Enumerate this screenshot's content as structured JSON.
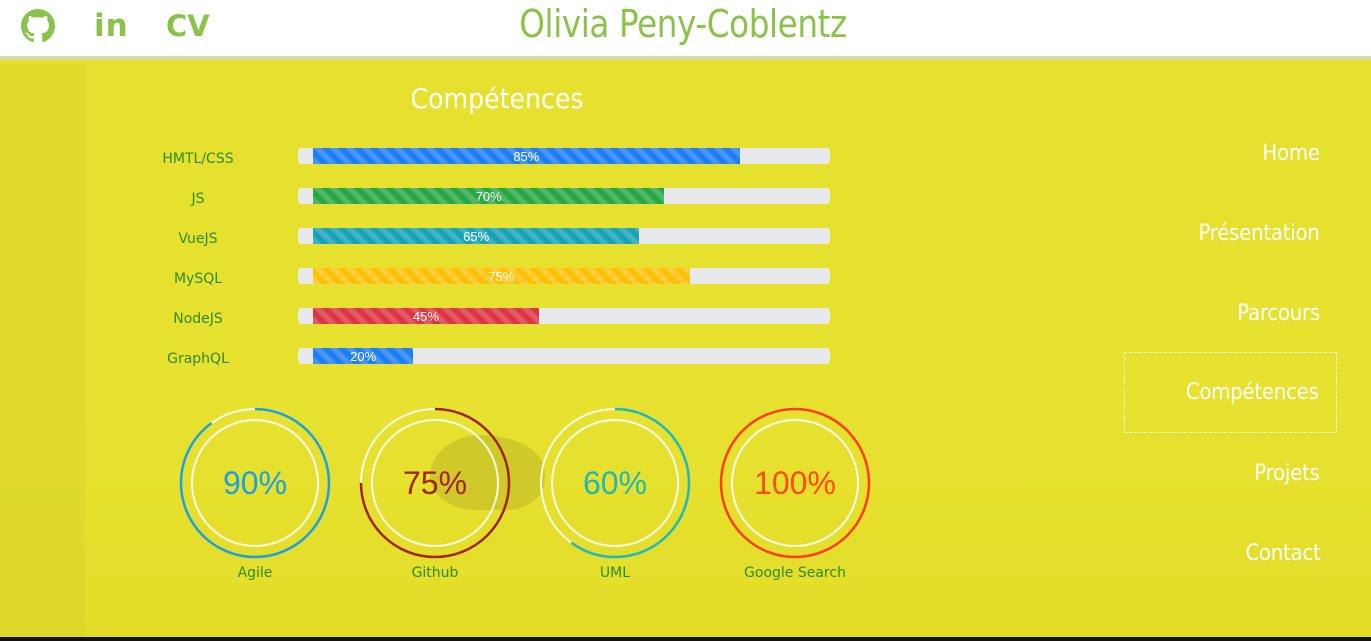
{
  "header": {
    "title": "Olivia Peny-Coblentz",
    "social": [
      {
        "icon": "github-icon",
        "label": ""
      },
      {
        "icon": "linkedin-icon",
        "label": "in"
      },
      {
        "icon": "cv-icon",
        "label": "CV"
      }
    ],
    "accent_color": "#8bc34a"
  },
  "skills": {
    "title": "Compétences",
    "bars": [
      {
        "label": "HMTL/CSS",
        "percent": 85,
        "text": "85%",
        "color": "#1e7ef5"
      },
      {
        "label": "JS",
        "percent": 70,
        "text": "70%",
        "color": "#28a745"
      },
      {
        "label": "VueJS",
        "percent": 65,
        "text": "65%",
        "color": "#17a2b8"
      },
      {
        "label": "MySQL",
        "percent": 75,
        "text": "75%",
        "color": "#ffc107"
      },
      {
        "label": "NodeJS",
        "percent": 45,
        "text": "45%",
        "color": "#dc3545"
      },
      {
        "label": "GraphQL",
        "percent": 20,
        "text": "20%",
        "color": "#1e7ef5"
      }
    ],
    "circles": [
      {
        "label": "Agile",
        "percent": 90,
        "text": "90%",
        "color": "#1ba1e2",
        "ring_color": "#1ba1e2"
      },
      {
        "label": "Github",
        "percent": 75,
        "text": "75%",
        "color": "#a0260e",
        "ring_color": "#a0260e"
      },
      {
        "label": "UML",
        "percent": 60,
        "text": "60%",
        "color": "#20b8b0",
        "ring_color": "#20b8c0"
      },
      {
        "label": "Google Search",
        "percent": 100,
        "text": "100%",
        "color": "#ff4a12",
        "ring_color": "#ff3d10"
      }
    ]
  },
  "nav": {
    "items": [
      "Home",
      "Présentation",
      "Parcours",
      "Compétences",
      "Projets",
      "Contact"
    ],
    "active": "Compétences"
  },
  "colors": {
    "background": "#e6e02e",
    "label_green": "#2e8b16"
  }
}
